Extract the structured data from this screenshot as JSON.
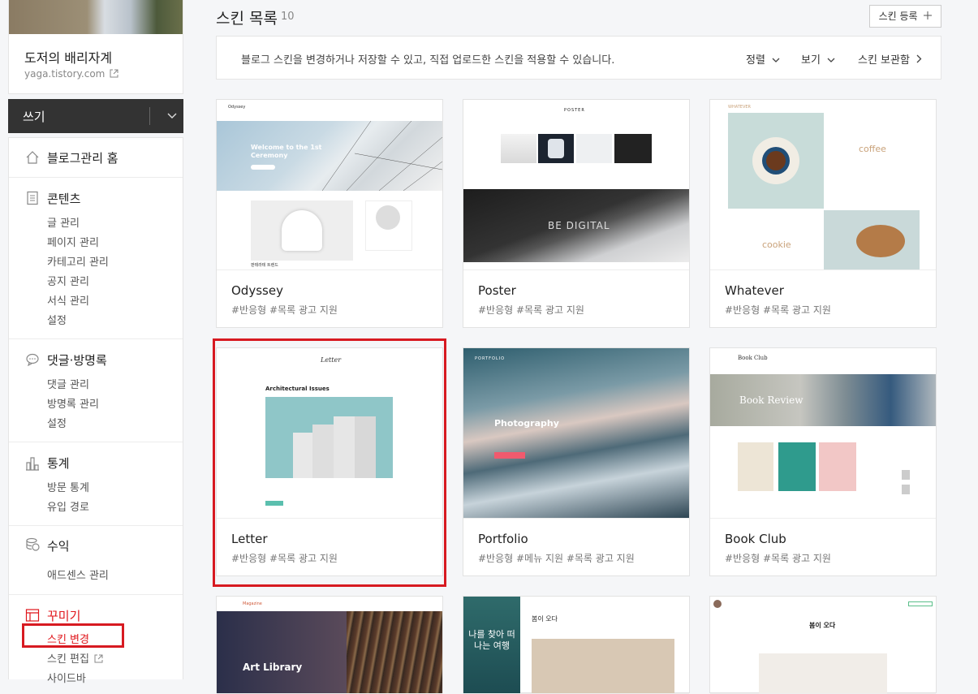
{
  "sidebar": {
    "blog_name": "도저의 배리자계",
    "blog_url": "yaga.tistory.com",
    "write_label": "쓰기",
    "sections": [
      {
        "title": "블로그관리 홈",
        "icon": "home-icon",
        "items": []
      },
      {
        "title": "콘텐츠",
        "icon": "document-icon",
        "items": [
          "글 관리",
          "페이지 관리",
          "카테고리 관리",
          "공지 관리",
          "서식 관리",
          "설정"
        ]
      },
      {
        "title": "댓글·방명록",
        "icon": "comment-icon",
        "items": [
          "댓글 관리",
          "방명록 관리",
          "설정"
        ]
      },
      {
        "title": "통계",
        "icon": "chart-icon",
        "items": [
          "방문 통계",
          "유입 경로"
        ]
      },
      {
        "title": "수익",
        "icon": "coins-icon",
        "items": [
          "애드센스 관리"
        ]
      },
      {
        "title": "꾸미기",
        "icon": "layout-icon",
        "items": [
          "스킨 변경",
          "스킨 편집",
          "사이드바"
        ]
      }
    ]
  },
  "main": {
    "title": "스킨 목록",
    "count": "10",
    "register_label": "스킨 등록",
    "info": "블로그 스킨을 변경하거나 저장할 수 있고, 직접 업로드한 스킨을 적용할 수 있습니다.",
    "sort_label": "정렬",
    "view_label": "보기",
    "storage_label": "스킨 보관함"
  },
  "skins": [
    {
      "name": "Odyssey",
      "tags": "#반응형   #목록 광고 지원",
      "thumb": {
        "hero": "Welcome to the 1st Ceremony",
        "footer": "판테라테 트렌드"
      }
    },
    {
      "name": "Poster",
      "tags": "#반응형   #목록 광고 지원",
      "thumb": {
        "logo": "POSTER",
        "hero": "BE DIGITAL"
      }
    },
    {
      "name": "Whatever",
      "tags": "#반응형   #목록 광고 지원",
      "thumb": {
        "logo": "WHATEVER",
        "coffee": "coffee",
        "cookie": "cookie"
      }
    },
    {
      "name": "Letter",
      "tags": "#반응형   #목록 광고 지원",
      "thumb": {
        "logo": "Letter",
        "heading": "Architectural Issues"
      }
    },
    {
      "name": "Portfolio",
      "tags": "#반응형   #메뉴 지원   #목록 광고 지원",
      "thumb": {
        "logo": "PORTFOLIO",
        "hero": "Photography"
      }
    },
    {
      "name": "Book Club",
      "tags": "#반응형   #목록 광고 지원",
      "thumb": {
        "logo": "Book Club",
        "hero": "Book Review"
      }
    },
    {
      "name": "",
      "tags": "",
      "thumb": {
        "logo": "Magazine",
        "hero": "Art Library"
      }
    },
    {
      "name": "",
      "tags": "",
      "thumb": {
        "title": "봄이 오다",
        "side": "나를 찾아 떠나는 여행"
      }
    },
    {
      "name": "",
      "tags": "",
      "thumb": {
        "title": "봄이 오다"
      }
    }
  ],
  "colors": {
    "accent": "#e0161b",
    "dark": "#333333"
  }
}
